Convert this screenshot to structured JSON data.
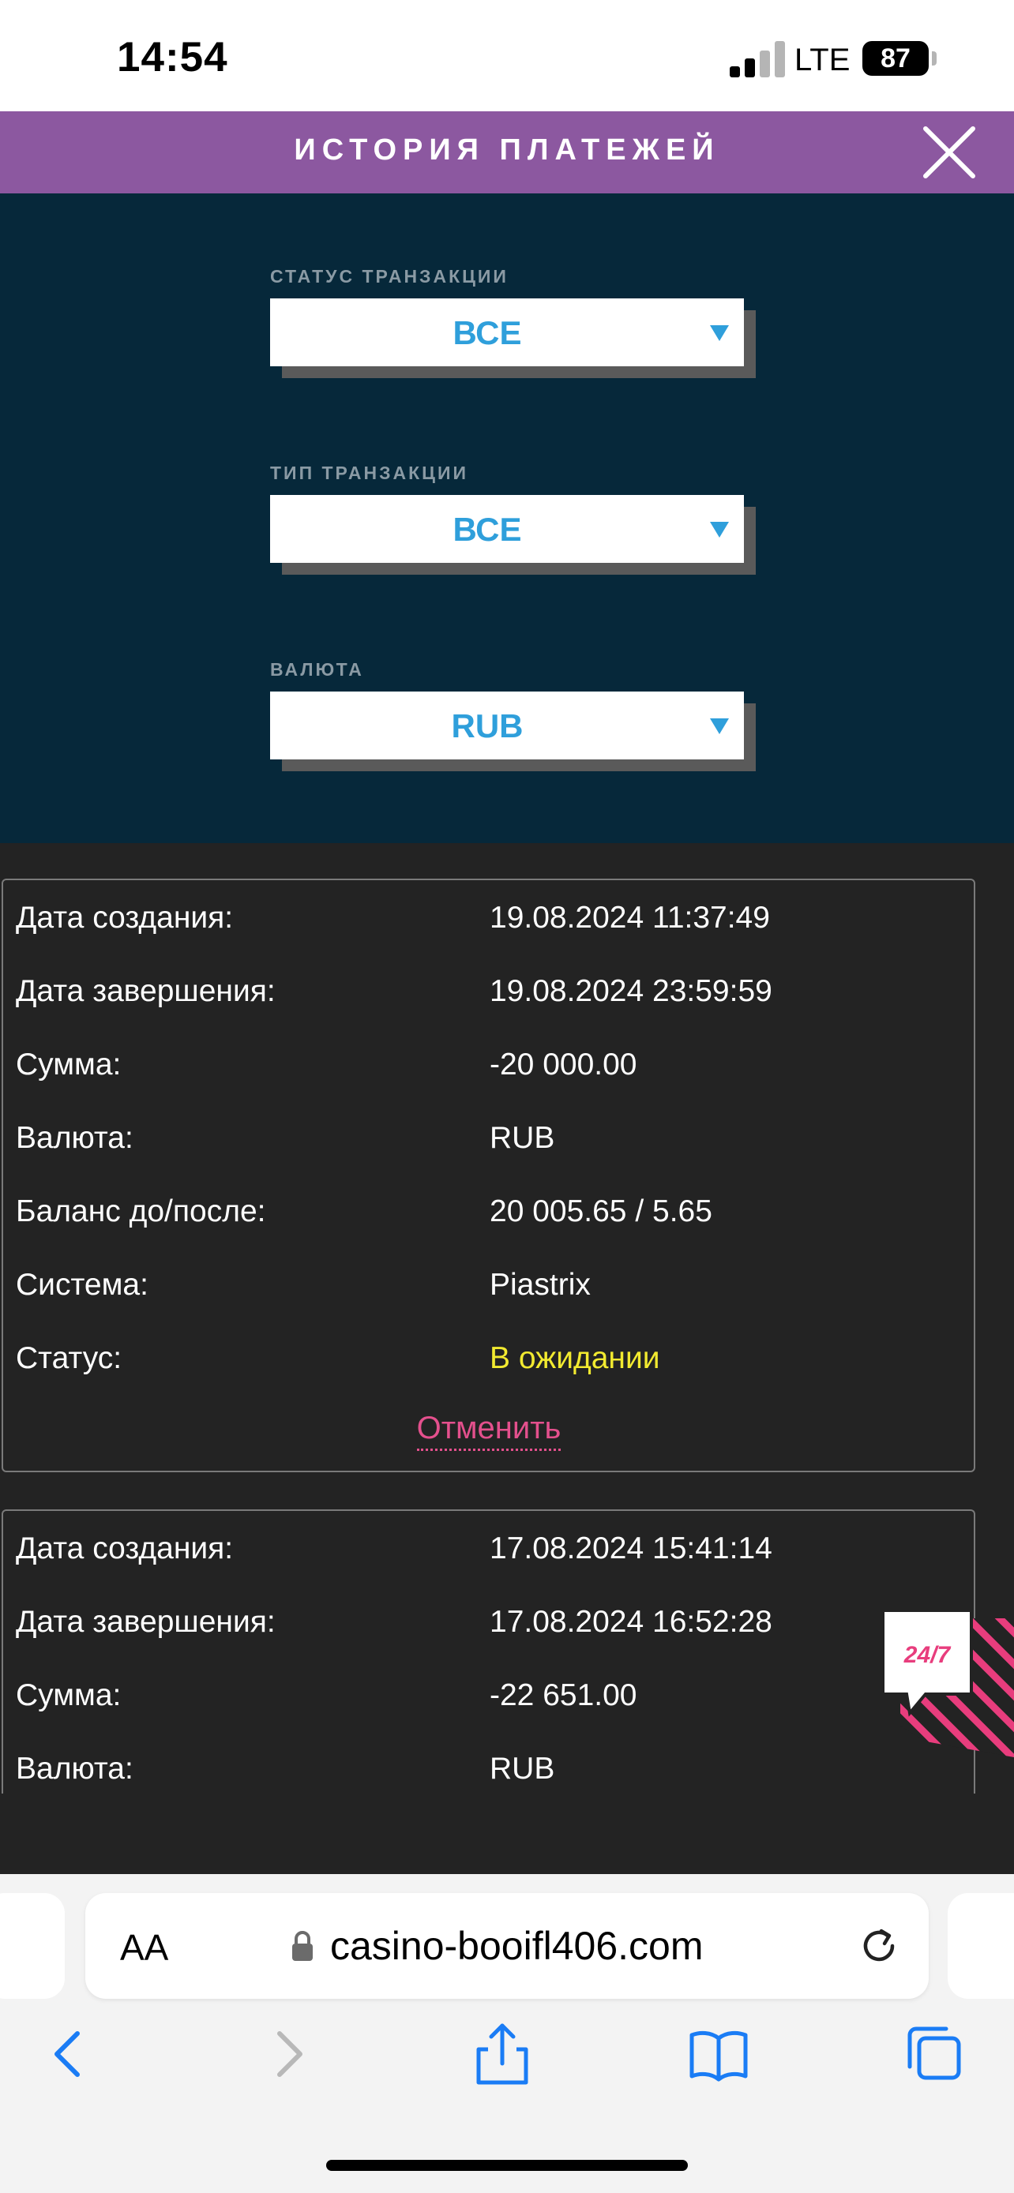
{
  "status_bar": {
    "time": "14:54",
    "network": "LTE",
    "battery": "87"
  },
  "header": {
    "title": "ИСТОРИЯ ПЛАТЕЖЕЙ"
  },
  "filters": [
    {
      "label": "СТАТУС ТРАНЗАКЦИИ",
      "value": "ВСЕ"
    },
    {
      "label": "ТИП ТРАНЗАКЦИИ",
      "value": "ВСЕ"
    },
    {
      "label": "ВАЛЮТА",
      "value": "RUB"
    }
  ],
  "transactions": [
    {
      "rows": [
        {
          "k": "Дата создания:",
          "v": "19.08.2024 11:37:49"
        },
        {
          "k": "Дата завершения:",
          "v": "19.08.2024 23:59:59"
        },
        {
          "k": "Сумма:",
          "v": "-20 000.00"
        },
        {
          "k": "Валюта:",
          "v": "RUB"
        },
        {
          "k": "Баланс до/после:",
          "v": "20 005.65 / 5.65"
        },
        {
          "k": "Система:",
          "v": "Piastrix"
        },
        {
          "k": "Статус:",
          "v": "В ожидании"
        }
      ],
      "cancel_label": "Отменить"
    },
    {
      "rows": [
        {
          "k": "Дата создания:",
          "v": "17.08.2024 15:41:14"
        },
        {
          "k": "Дата завершения:",
          "v": "17.08.2024 16:52:28"
        },
        {
          "k": "Сумма:",
          "v": "-22 651.00"
        },
        {
          "k": "Валюта:",
          "v": "RUB"
        }
      ]
    }
  ],
  "support_badge": {
    "label": "24/7"
  },
  "browser": {
    "text_size_label": "AA",
    "url": "casino-booifl406.com"
  },
  "colors": {
    "header": "#8c58a0",
    "filters_bg": "#06283a",
    "accent_blue": "#2f9fdb",
    "pending": "#f2ea30",
    "cancel": "#e4508d"
  }
}
